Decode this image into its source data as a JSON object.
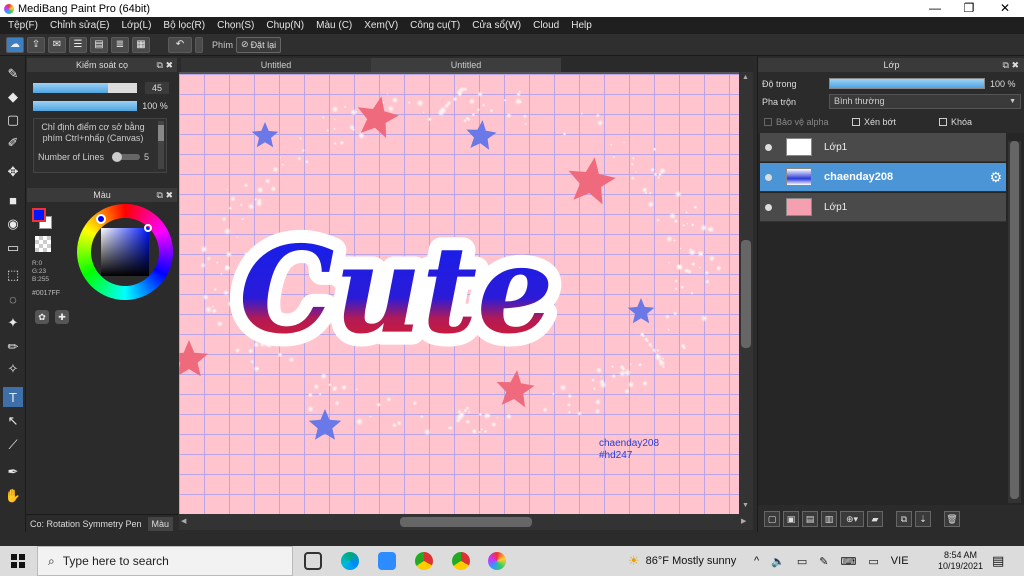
{
  "window": {
    "title": "MediBang Paint Pro (64bit)",
    "minimize": "—",
    "restore": "❐",
    "close": "✕"
  },
  "menu": [
    "Tệp(F)",
    "Chỉnh sửa(E)",
    "Lớp(L)",
    "Bộ lọc(R)",
    "Chọn(S)",
    "Chụp(N)",
    "Màu (C)",
    "Xem(V)",
    "Công cụ(T)",
    "Cửa sổ(W)",
    "Cloud",
    "Help"
  ],
  "toolbar": {
    "undo_icon": "undo-icon",
    "snap_label": "Phím",
    "reset_label": "Đặt lại"
  },
  "brush_panel": {
    "title": "Kiểm soát cọ",
    "size_value": "45",
    "opacity_value": "100 %",
    "size_level": 0.72,
    "opacity_level": 1.0,
    "hint": "Chỉ định điểm cơ sở bằng phím Ctrl+nhấp (Canvas)",
    "lines_label": "Number of Lines",
    "lines_value": "5"
  },
  "color_panel": {
    "title": "Màu",
    "r": "R:0",
    "g": "G:23",
    "b": "B:255",
    "hex": "#0017FF",
    "fg_color": "#0017FF",
    "bg_color": "#ffffff"
  },
  "left_footer": {
    "brush_tab": "Co: Rotation Symmetry Pen",
    "color_tab": "Màu"
  },
  "tabs": [
    "Untitled",
    "Untitled"
  ],
  "canvas": {
    "title_text": "Cute",
    "credit_line1": "chaenday208",
    "credit_line2": "#hd247",
    "background": "#ffc4cd"
  },
  "layer_panel": {
    "title": "Lớp",
    "opacity_label": "Độ trong",
    "opacity_value": "100 %",
    "blend_label": "Pha trộn",
    "blend_value": "Bình thường",
    "protect_alpha": "Bảo vệ alpha",
    "clip": "Xén bớt",
    "lock": "Khóa",
    "layers": [
      {
        "name": "Lớp1",
        "selected": false
      },
      {
        "name": "chaenday208",
        "selected": true
      },
      {
        "name": "Lớp1",
        "selected": false
      }
    ]
  },
  "taskbar": {
    "search_placeholder": "Type here to search",
    "weather": "86°F  Mostly sunny",
    "lang": "VIE",
    "time": "8:54 AM",
    "date": "10/19/2021"
  }
}
